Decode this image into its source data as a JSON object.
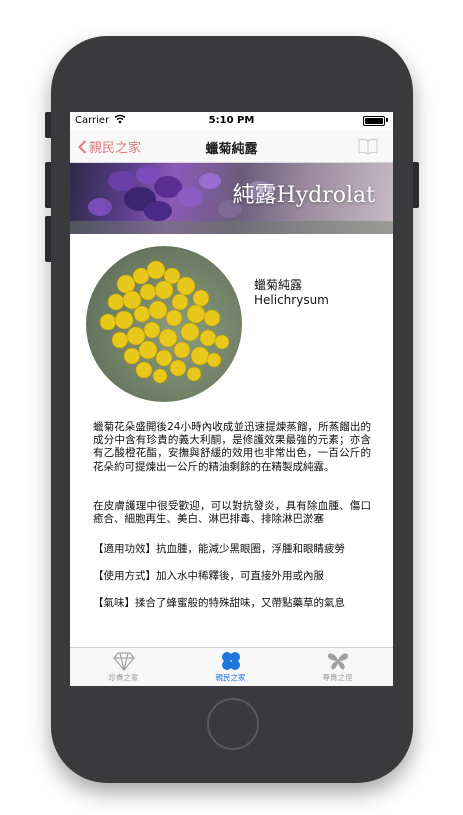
{
  "status": {
    "carrier": "Carrier",
    "time": "5:10 PM"
  },
  "nav": {
    "back_label": "親民之家",
    "title": "蠟菊純露"
  },
  "banner": {
    "text": "純露Hydrolat"
  },
  "plant": {
    "name_zh": "蠟菊純露",
    "name_en": "Helichrysum"
  },
  "content": {
    "p1": "蠟菊花朵盛開後24小時內收成並迅速提煉蒸餾，所蒸餾出的成分中含有珍貴的義大利酮，是修護效果最強的元素；亦含有乙酸橙花酯，安撫與舒緩的效用也非常出色，一百公斤的花朵約可提煉出一公斤的精油剩餘的在精製成純露。",
    "p2": "在皮膚護理中很受歡迎，可以對抗發炎，具有除血腫、傷口癒合、細胞再生、美白、淋巴排毒、排除淋巴淤塞",
    "p3": "【適用功效】抗血腫，能減少黑眼圈，浮腫和眼睛疲勞",
    "p4": "【使用方式】加入水中稀釋後，可直接外用或內服",
    "p5": "【氣味】揉合了蜂蜜般的特殊甜味，又帶點藥草的氣息"
  },
  "tabs": [
    {
      "label": "珍貴之家",
      "icon": "diamond-icon"
    },
    {
      "label": "親民之家",
      "icon": "clover-icon",
      "active": true
    },
    {
      "label": "尊貴之徑",
      "icon": "butterfly-icon"
    }
  ],
  "colors": {
    "accent": "#1f76e0",
    "back": "#e07a7a"
  }
}
